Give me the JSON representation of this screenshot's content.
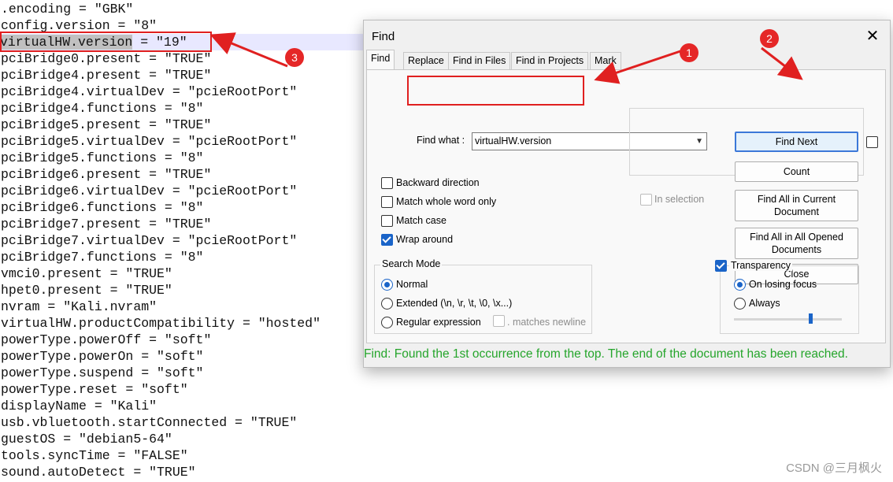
{
  "editor": {
    "lines": [
      ".encoding = \"GBK\"",
      "config.version = \"8\"",
      "virtualHW.version = \"19\"",
      "pciBridge0.present = \"TRUE\"",
      "pciBridge4.present = \"TRUE\"",
      "pciBridge4.virtualDev = \"pcieRootPort\"",
      "pciBridge4.functions = \"8\"",
      "pciBridge5.present = \"TRUE\"",
      "pciBridge5.virtualDev = \"pcieRootPort\"",
      "pciBridge5.functions = \"8\"",
      "pciBridge6.present = \"TRUE\"",
      "pciBridge6.virtualDev = \"pcieRootPort\"",
      "pciBridge6.functions = \"8\"",
      "pciBridge7.present = \"TRUE\"",
      "pciBridge7.virtualDev = \"pcieRootPort\"",
      "pciBridge7.functions = \"8\"",
      "vmci0.present = \"TRUE\"",
      "hpet0.present = \"TRUE\"",
      "nvram = \"Kali.nvram\"",
      "virtualHW.productCompatibility = \"hosted\"",
      "powerType.powerOff = \"soft\"",
      "powerType.powerOn = \"soft\"",
      "powerType.suspend = \"soft\"",
      "powerType.reset = \"soft\"",
      "displayName = \"Kali\"",
      "usb.vbluetooth.startConnected = \"TRUE\"",
      "guestOS = \"debian5-64\"",
      "tools.syncTime = \"FALSE\"",
      "sound.autoDetect = \"TRUE\""
    ],
    "active_line_index": 2,
    "highlighted_text": "virtualHW.version"
  },
  "dialog": {
    "title": "Find",
    "close_glyph": "✕",
    "tabs": [
      {
        "label": "Find",
        "active": true
      },
      {
        "label": "Replace",
        "active": false
      },
      {
        "label": "Find in Files",
        "active": false
      },
      {
        "label": "Find in Projects",
        "active": false
      },
      {
        "label": "Mark",
        "active": false
      }
    ],
    "find_what_label": "Find what :",
    "find_what_value": "virtualHW.version",
    "buttons": {
      "find_next": "Find Next",
      "count": "Count",
      "find_all_current": "Find All in Current Document",
      "find_all_opened": "Find All in All Opened Documents",
      "close": "Close"
    },
    "in_selection": {
      "label": "In selection",
      "checked": false,
      "enabled": false
    },
    "options": [
      {
        "label": "Backward direction",
        "checked": false
      },
      {
        "label": "Match whole word only",
        "checked": false
      },
      {
        "label": "Match case",
        "checked": false
      },
      {
        "label": "Wrap around",
        "checked": true
      }
    ],
    "search_mode": {
      "title": "Search Mode",
      "options": [
        {
          "label": "Normal",
          "checked": true
        },
        {
          "label": "Extended (\\n, \\r, \\t, \\0, \\x...)",
          "checked": false
        },
        {
          "label": "Regular expression",
          "checked": false
        }
      ],
      "matches_newline_label": ". matches newline",
      "matches_newline_checked": false
    },
    "transparency": {
      "label": "Transparency",
      "checked": true,
      "options": [
        {
          "label": "On losing focus",
          "checked": true
        },
        {
          "label": "Always",
          "checked": false
        }
      ],
      "slider_value_fraction": 0.7
    },
    "status": "Find: Found the 1st occurrence from the top. The end of the document has been reached."
  },
  "annotations": {
    "badges": [
      "1",
      "2",
      "3"
    ],
    "color": "#e02020"
  },
  "watermark": "CSDN @三月枫火"
}
